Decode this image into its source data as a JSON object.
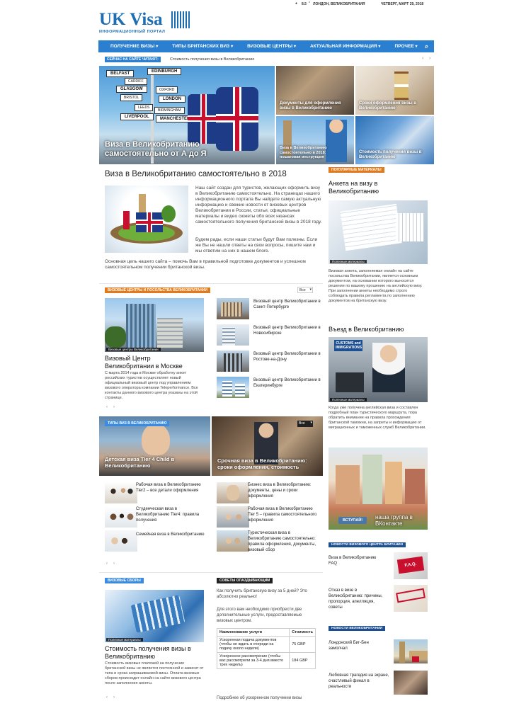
{
  "topbar": {
    "temp": "8.5",
    "temp_unit": "c",
    "location": "ЛОНДОН, ВЕЛИКОБРИТАНИЯ",
    "date": "ЧЕТВЕРГ, МАРТ 29, 2018"
  },
  "logo": {
    "text": "UK Visa",
    "subtitle": "ИНФОРМАЦИОННЫЙ ПОРТАЛ"
  },
  "nav": {
    "items": [
      "ПОЛУЧЕНИЕ ВИЗЫ",
      "ТИПЫ БРИТАНСКИХ ВИЗ",
      "ВИЗОВЫЕ ЦЕНТРЫ",
      "АКТУАЛЬНАЯ ИНФОРМАЦИЯ",
      "ПРОЧЕЕ"
    ]
  },
  "ticker": {
    "label": "СЕЙЧАС НА САЙТЕ ЧИТАЮТ:",
    "text": "Стоимость получения визы в Великобританию"
  },
  "hero": {
    "main_caption": "Виза в Великобританию самостоятельно от А до Я",
    "signs": [
      "BELFAST",
      "EDINBURGH",
      "CARDIFF",
      "GLASGOW",
      "OXFORD",
      "BRISTOL",
      "LONDON",
      "LEEDS",
      "BIRMINGHAM",
      "LIVERPOOL",
      "MANCHESTER"
    ],
    "tiles": [
      "Документы для оформления визы в Великобританию",
      "Сроки оформления визы в Великобританию",
      "Виза в Великобританию самостоятельно в 2018: пошаговая инструкция",
      "Стоимость получения визы в Великобританию"
    ]
  },
  "article": {
    "title": "Виза в Великобританию самостоятельно в 2018",
    "p1": "Наш сайт создан для туристов, желающих оформить визу в Великобританию самостоятельно. На страницах нашего информационного портала Вы найдете самую актуальную информацию и свежие новости от визовых центров Великобритании в России, статьи, официальные материалы и видео сюжеты обо всех нюансах самостоятельного получения британской визы в 2018 году.",
    "p2": "Будем рады, если наши статьи будут Вам полезны. Если же Вы не нашли ответы на свои вопросы, пишите нам и мы ответим на них в нашем блоге.",
    "p3": "Основная цель нашего сайта – помочь Вам в правильной подготовке документов и успешном самостоятельном получении британской визы."
  },
  "centers": {
    "tag": "ВИЗОВЫЕ ЦЕНТРЫ И ПОСОЛЬСТВА ВЕЛИКОБРИТАНИИ",
    "filter": "Все",
    "main_label": "Визовые центры Великобритании",
    "main_title": "Визовый Центр Великобритании в Москве",
    "main_text": "С марта 2014 года в Москве обработку анкет российских туристов осуществляет новый официальный визовый центр под управлением визового оператора компании Teleperformance. Все контакты данного визового центра указаны на этой странице.",
    "items": [
      "Визовый центр Великобритании в Санкт-Петербурге",
      "Визовый центр Великобритании в Новосибирске",
      "Визовый центр Великобритании в Ростове-на-Дону",
      "Визовый центр Великобритании в Екатеринбурге"
    ]
  },
  "types": {
    "tag": "ТИПЫ ВИЗ В ВЕЛИКОБРИТАНИЮ",
    "filter": "Все",
    "big": [
      "Детская виза Tier 4 Child в Великобританию",
      "Срочная виза в Великобританию: сроки оформления, стоимость"
    ],
    "items": [
      "Рабочая виза в Великобританию Tier2 – все детали оформления",
      "Бизнес виза в Великобританию: документы, цены и сроки оформления",
      "Студенческая виза в Великобританию Tier4: правила получения",
      "Рабочая виза в Великобританию Tier 5 – правила самостоятельного оформления",
      "Семейная виза в Великобританию",
      "Туристическая виза в Великобританию самостоятельно: правила оформления, документы, визовый сбор"
    ]
  },
  "fees": {
    "tag": "ВИЗОВЫЕ СБОРЫ",
    "label": "Полезные материалы",
    "title": "Стоимость получения визы в Великобританию",
    "text": "Стоимость визовых платежей на получение британской визы не является постоянной и зависит от типа и срока запрашиваемой визы. Оплата визовых сборов происходит онлайн на сайте визового центра после заполнения анкеты."
  },
  "late": {
    "tag": "СОВЕТЫ ОПАЗДЫВАЮЩИМ",
    "q": "Как получить британскую визу за 5 дней? Это абсолютно реально!",
    "p": "Для этого вам необходимо приобрести две дополнительные услуги, предоставляемые визовых центром.",
    "th": [
      "Наименование услуги",
      "Стоимость"
    ],
    "rows": [
      [
        "Ускоренная подача документов (чтобы не ждать в очереди на подачу около недели)",
        "75 GBP"
      ],
      [
        "Ускоренное рассмотрение (чтобы вас рассмотрели за 3-4 дня вместо трех недель)",
        "184 GBP"
      ]
    ],
    "more": "Подробнее об ускоренном получении визы"
  },
  "sidebar": {
    "popular_tag": "ПОПУЛЯРНЫЕ МАТЕРИАЛЫ",
    "p1_title": "Анкета на визу в Великобританию",
    "p1_label": "Полезные материалы",
    "p1_text": "Визовая анкета, заполняемая онлайн на сайте посольства Великобритании, является основным документом, на основании которого выносится решение по вашему прошению на английскую визу. При заполнении анкеты необходимо строго соблюдать правила регламента по заполнению документов на британскую визу.",
    "p2_title": "Въезд в Великобританию",
    "p2_label": "Полезные материалы",
    "p2_sign": "CUSTOMS and IMMIGRATIONS",
    "p2_text": "Когда уже получена английская виза и составлен подробный план туристического маршрута, пора обратить внимание на правила прохождения британской таможни, на запреты и информацию от миграционных и таможенных служб Великобритании.",
    "vk_btn": "ВСТУПАЙ!",
    "vk_text": "наша группа в ВКонтакте",
    "news_vc_tag": "НОВОСТИ ВИЗОВОГО ЦЕНТРА БРИТАНИИ",
    "news_vc": [
      "Виза в Великобританию FAQ",
      "Отказ в визе в Великобританию: причины, пропорция, апелляция, советы"
    ],
    "faq": "F.A.Q.",
    "news_uk_tag": "НОВОСТИ ВЕЛИКОБРИТАНИИ",
    "news_uk": [
      "Лондонский Биг-Бен замолчал",
      "Любовная трагедия на экране, счастливый финал в реальности"
    ]
  },
  "colors": {
    "nav": "#2b7fd0",
    "ticker": "#2b7fd0",
    "tag_blue": "#3b8ce0",
    "tag_orange": "#e07a1f",
    "tag_dark": "#222222"
  }
}
